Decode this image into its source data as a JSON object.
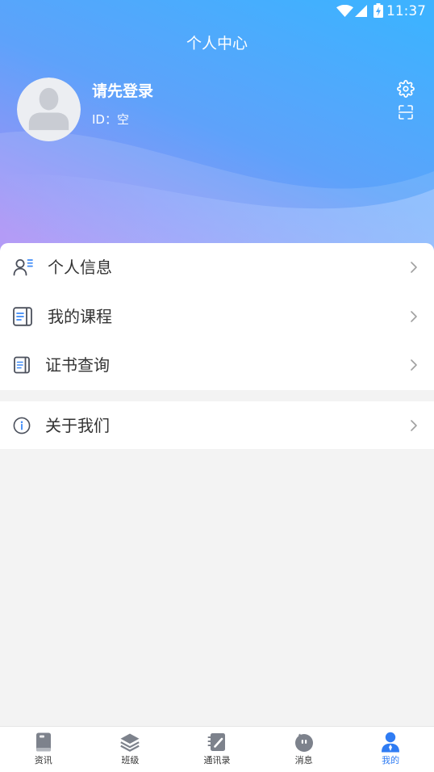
{
  "status_bar": {
    "time": "11:37",
    "icons": [
      "wifi-icon",
      "signal-icon",
      "battery-charging-icon"
    ]
  },
  "header": {
    "title": "个人中心",
    "actions": [
      {
        "icon": "settings-gear-icon"
      },
      {
        "icon": "scan-icon"
      }
    ]
  },
  "profile": {
    "avatar_icon": "default-avatar-icon",
    "name": "请先登录",
    "id_text": "ID：空"
  },
  "menu_groups": [
    {
      "items": [
        {
          "label": "个人信息",
          "icon": "user-info-icon"
        },
        {
          "label": "我的课程",
          "icon": "course-book-icon"
        },
        {
          "label": "证书查询",
          "icon": "certificate-icon"
        }
      ]
    },
    {
      "items": [
        {
          "label": "关于我们",
          "icon": "info-icon"
        }
      ]
    }
  ],
  "tab_bar": {
    "items": [
      {
        "label": "资讯",
        "icon": "news-icon",
        "active": false
      },
      {
        "label": "班级",
        "icon": "class-layers-icon",
        "active": false
      },
      {
        "label": "通讯录",
        "icon": "contacts-notebook-icon",
        "active": false
      },
      {
        "label": "消息",
        "icon": "message-icon",
        "active": false
      },
      {
        "label": "我的",
        "icon": "profile-person-icon",
        "active": true
      }
    ]
  },
  "colors": {
    "accent": "#2f7cf3",
    "header_top": "#3eb2ff",
    "header_bottom": "#a98ef5",
    "text": "#333333",
    "icon_gray": "#7d828c",
    "page_bg": "#f3f3f3"
  }
}
